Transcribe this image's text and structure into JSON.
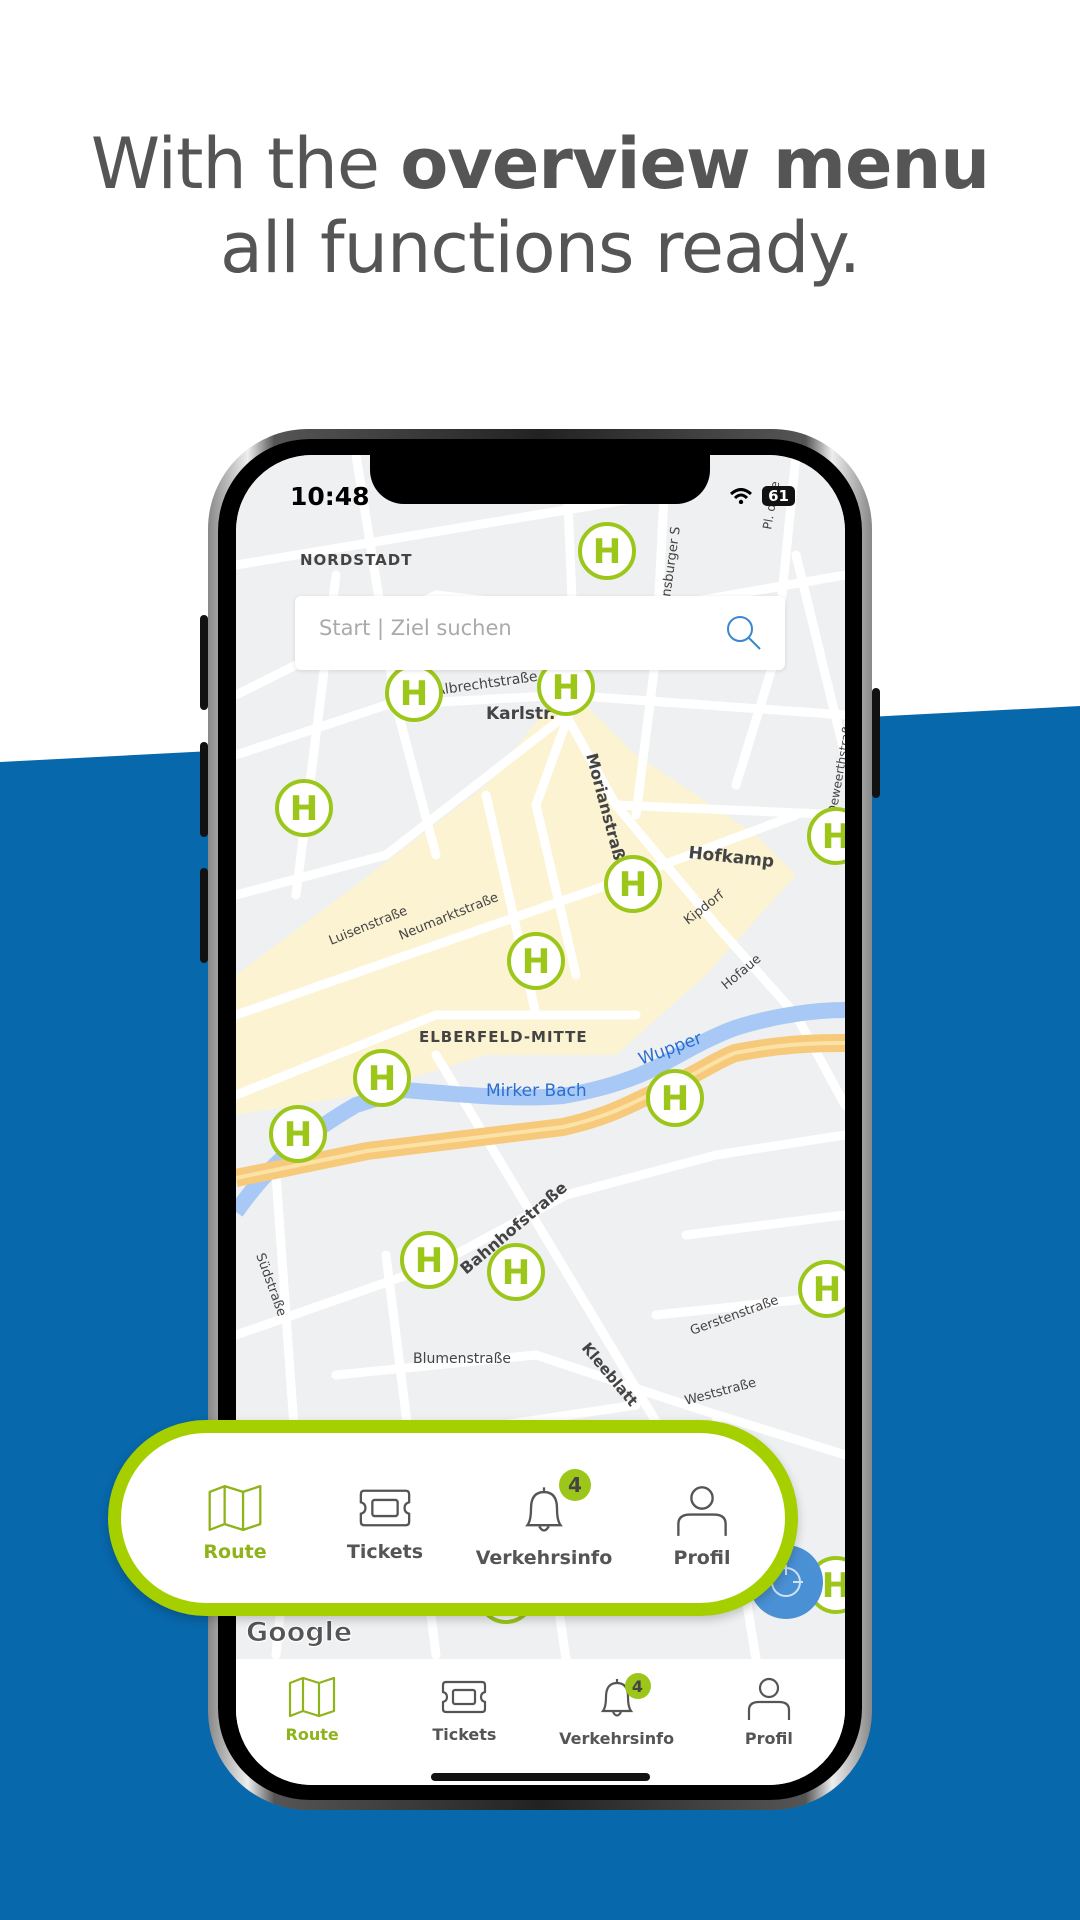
{
  "headline": {
    "prefix": "With the ",
    "bold": "overview menu",
    "line2": "all functions ready."
  },
  "colors": {
    "brand_blue": "#0868ac",
    "accent_green": "#a6cf00",
    "stop_green": "#9cc71a",
    "locate_blue": "#4a90d4"
  },
  "status_bar": {
    "time": "10:48",
    "battery": "61",
    "wifi_icon": "wifi-icon"
  },
  "search": {
    "placeholder": "Start | Ziel suchen",
    "icon": "search-icon"
  },
  "map": {
    "attribution": "Google",
    "labels": [
      "NORDSTADT",
      "Karlstr.",
      "Albrechtstraße",
      "Morianstraße",
      "Hofkamp",
      "Luisenstraße",
      "Neumarktstraße",
      "Kipdorf",
      "Hofaue",
      "ELBERFELD-MITTE",
      "Mirker Bach",
      "Wupper",
      "Bahnhofstraße",
      "Südstraße",
      "Blumenstraße",
      "Kleeblatt",
      "Gerstenstraße",
      "Weststraße",
      "Deweerthstraße",
      "ensburger S",
      "Pl. d. Re"
    ],
    "stop_symbol": "H"
  },
  "tabs": [
    {
      "label": "Route",
      "icon": "map-icon",
      "active": true
    },
    {
      "label": "Tickets",
      "icon": "ticket-icon",
      "active": false
    },
    {
      "label": "Verkehrsinfo",
      "icon": "bell-icon",
      "badge": "4",
      "active": false
    },
    {
      "label": "Profil",
      "icon": "person-icon",
      "active": false
    }
  ]
}
